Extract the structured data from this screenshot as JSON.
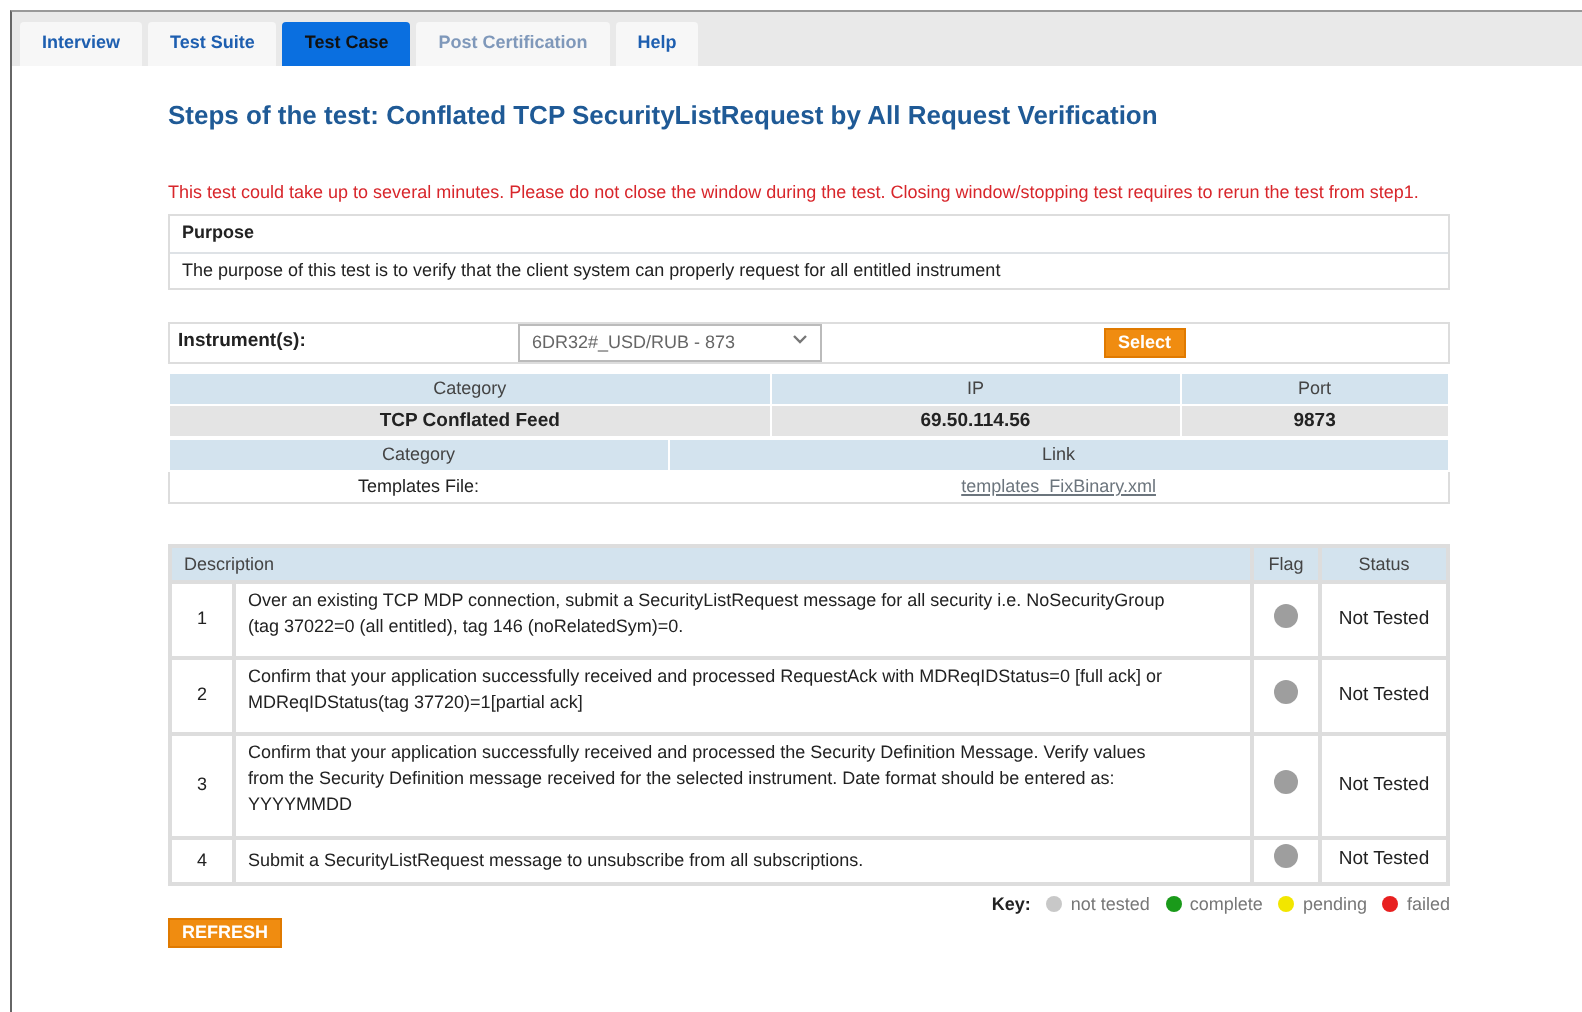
{
  "tabs": [
    {
      "label": "Interview",
      "selected": false,
      "disabled": false
    },
    {
      "label": "Test Suite",
      "selected": false,
      "disabled": false
    },
    {
      "label": "Test Case",
      "selected": true,
      "disabled": false
    },
    {
      "label": "Post Certification",
      "selected": false,
      "disabled": true
    },
    {
      "label": "Help",
      "selected": false,
      "disabled": false
    }
  ],
  "title": "Steps of the test: Conflated TCP SecurityListRequest by All Request Verification",
  "warning": "This test could take up to several minutes. Please do not close the window during the test. Closing window/stopping test requires to rerun the test from step1.",
  "purpose": {
    "heading": "Purpose",
    "text": "The purpose of this test is to verify that the client system can properly request for all entitled instrument"
  },
  "instrument": {
    "label": "Instrument(s):",
    "value": "6DR32#_USD/RUB - 873",
    "button": "Select"
  },
  "feed_table": {
    "columns": [
      "Category",
      "IP",
      "Port"
    ],
    "row": [
      "TCP Conflated Feed",
      "69.50.114.56",
      "9873"
    ]
  },
  "link_table": {
    "columns": [
      "Category",
      "Link"
    ],
    "row": [
      "Templates File:",
      "templates_FixBinary.xml"
    ]
  },
  "steps": {
    "columns": [
      "Description",
      "Flag",
      "Status"
    ],
    "rows": [
      {
        "number": "1",
        "description": "Over an existing TCP MDP connection, submit a SecurityListRequest message for all security i.e. NoSecurityGroup (tag 37022=0 (all entitled), tag 146 (noRelatedSym)=0.",
        "color": "#9e9e9e",
        "status": "Not Tested"
      },
      {
        "number": "2",
        "description": "Confirm that your application successfully received and processed RequestAck with MDReqIDStatus=0 [full ack] or MDReqIDStatus(tag 37720)=1[partial ack]",
        "color": "#9e9e9e",
        "status": "Not Tested"
      },
      {
        "number": "3",
        "description": "Confirm that your application successfully received and processed the Security Definition Message. Verify values from the Security Definition message received for the selected instrument. Date format should be entered as: YYYYMMDD",
        "color": "#9e9e9e",
        "status": "Not Tested"
      },
      {
        "number": "4",
        "description": "Submit a SecurityListRequest message to unsubscribe from all subscriptions.",
        "color": "#9e9e9e",
        "status": "Not Tested"
      }
    ]
  },
  "key": {
    "label": "Key:",
    "items": [
      {
        "label": "not tested",
        "color": "#c8c8c8"
      },
      {
        "label": "complete",
        "color": "#1a9a1a"
      },
      {
        "label": "pending",
        "color": "#f2e600"
      },
      {
        "label": "failed",
        "color": "#e82020"
      }
    ]
  },
  "refresh_button": "REFRESH"
}
